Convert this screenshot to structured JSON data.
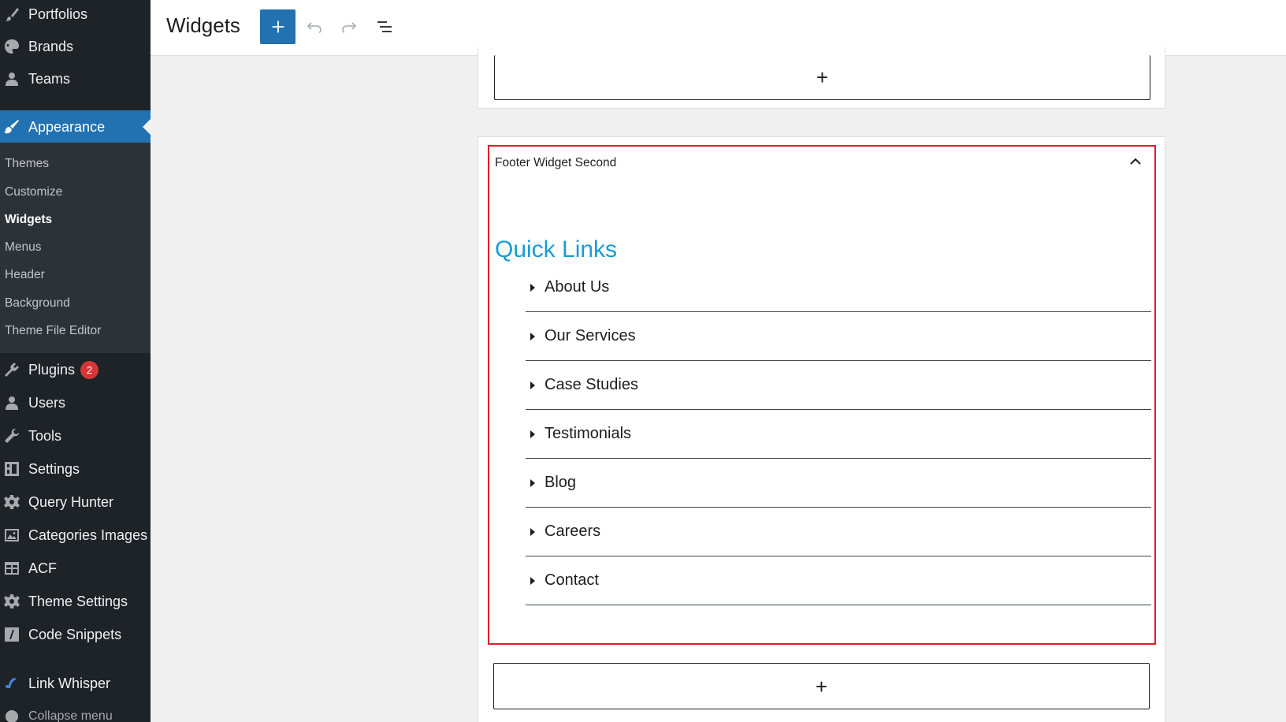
{
  "sidebar": {
    "items_top": [
      {
        "label": "Portfolios",
        "icon": "brush-icon"
      },
      {
        "label": "Brands",
        "icon": "palette-icon"
      },
      {
        "label": "Teams",
        "icon": "user-icon"
      }
    ],
    "active_item": {
      "label": "Appearance",
      "icon": "appearance-brush-icon"
    },
    "submenu": [
      {
        "label": "Themes"
      },
      {
        "label": "Customize"
      },
      {
        "label": "Widgets",
        "current": true
      },
      {
        "label": "Menus"
      },
      {
        "label": "Header"
      },
      {
        "label": "Background"
      },
      {
        "label": "Theme File Editor"
      }
    ],
    "items_bottom": [
      {
        "label": "Plugins",
        "icon": "plugin-icon",
        "badge": "2"
      },
      {
        "label": "Users",
        "icon": "users-icon"
      },
      {
        "label": "Tools",
        "icon": "wrench-icon"
      },
      {
        "label": "Settings",
        "icon": "settings-icon"
      },
      {
        "label": "Query Hunter",
        "icon": "gear-icon"
      },
      {
        "label": "Categories Images",
        "icon": "image-icon"
      },
      {
        "label": "ACF",
        "icon": "table-icon"
      },
      {
        "label": "Theme Settings",
        "icon": "gear-icon"
      },
      {
        "label": "Code Snippets",
        "icon": "code-icon"
      },
      {
        "label": "Link Whisper",
        "icon": "link-whisper-icon"
      }
    ],
    "collapse_label": "Collapse menu"
  },
  "topbar": {
    "title": "Widgets",
    "add_symbol": "+"
  },
  "editor": {
    "inserter_symbol": "+",
    "widget_area_title": "Footer Widget Second",
    "heading": "Quick Links",
    "links": [
      "About Us",
      "Our Services",
      "Case Studies",
      "Testimonials",
      "Blog",
      "Careers",
      "Contact"
    ]
  },
  "colors": {
    "sidebar_bg": "#1d2327",
    "submenu_bg": "#2c3338",
    "accent": "#2271b1",
    "heading": "#1b9ad6",
    "highlight_border": "#e21b2b",
    "badge": "#d63638"
  }
}
